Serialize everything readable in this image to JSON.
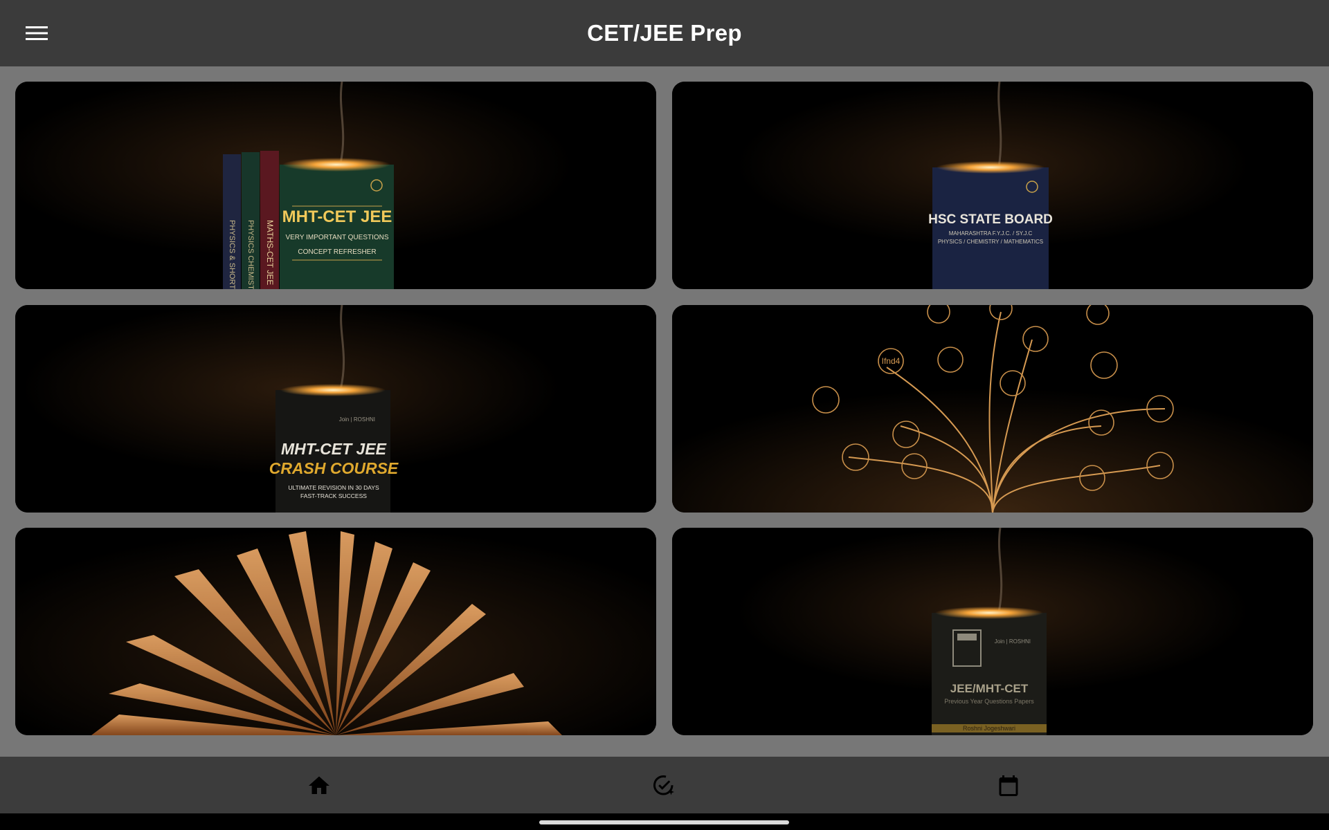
{
  "app": {
    "title": "CET/JEE Prep"
  },
  "header": {
    "menu_icon": "hamburger-menu-icon"
  },
  "cards": [
    {
      "name": "mht-cet-jee-books-card",
      "book_title": "MHT-CET JEE",
      "lines": [
        "VERY IMPORTANT QUESTIONS",
        "CONCEPT REFRESHER"
      ],
      "spines": [
        "PHYSICS & SHORTCUTS",
        "PHYSICS CHEMISTRY",
        "MATHS-CET JEE"
      ]
    },
    {
      "name": "hsc-state-board-card",
      "book_title": "HSC STATE BOARD",
      "lines": [
        "MAHARASHTRA F.Y.J.C. / SY.J.C",
        "PHYSICS / CHEMISTRY / MATHEMATICS"
      ]
    },
    {
      "name": "crash-course-card",
      "brand": "Join | ROSHNI",
      "book_title": "MHT-CET JEE",
      "book_subtitle": "CRASH COURSE",
      "lines": [
        "ULTIMATE REVISION IN 30 DAYS",
        "FAST-TRACK SUCCESS"
      ]
    },
    {
      "name": "knowledge-tree-card",
      "tree_label": "Ifnd4"
    },
    {
      "name": "open-book-card"
    },
    {
      "name": "previous-year-papers-card",
      "brand": "Join | ROSHNI",
      "book_title": "JEE/MHT-CET",
      "lines": [
        "Previous Year Questions Papers"
      ],
      "footer": "Roshni Jogeshwari"
    }
  ],
  "bottom_nav": {
    "items": [
      {
        "name": "home",
        "icon": "home-icon"
      },
      {
        "name": "tasks",
        "icon": "check-circle-sparkle-icon"
      },
      {
        "name": "calendar",
        "icon": "calendar-icon"
      }
    ]
  },
  "colors": {
    "topbar": "#3b3b3b",
    "content_bg": "#777777",
    "bottombar": "#3c3c3c",
    "accent_glow": "#f5b64a"
  }
}
